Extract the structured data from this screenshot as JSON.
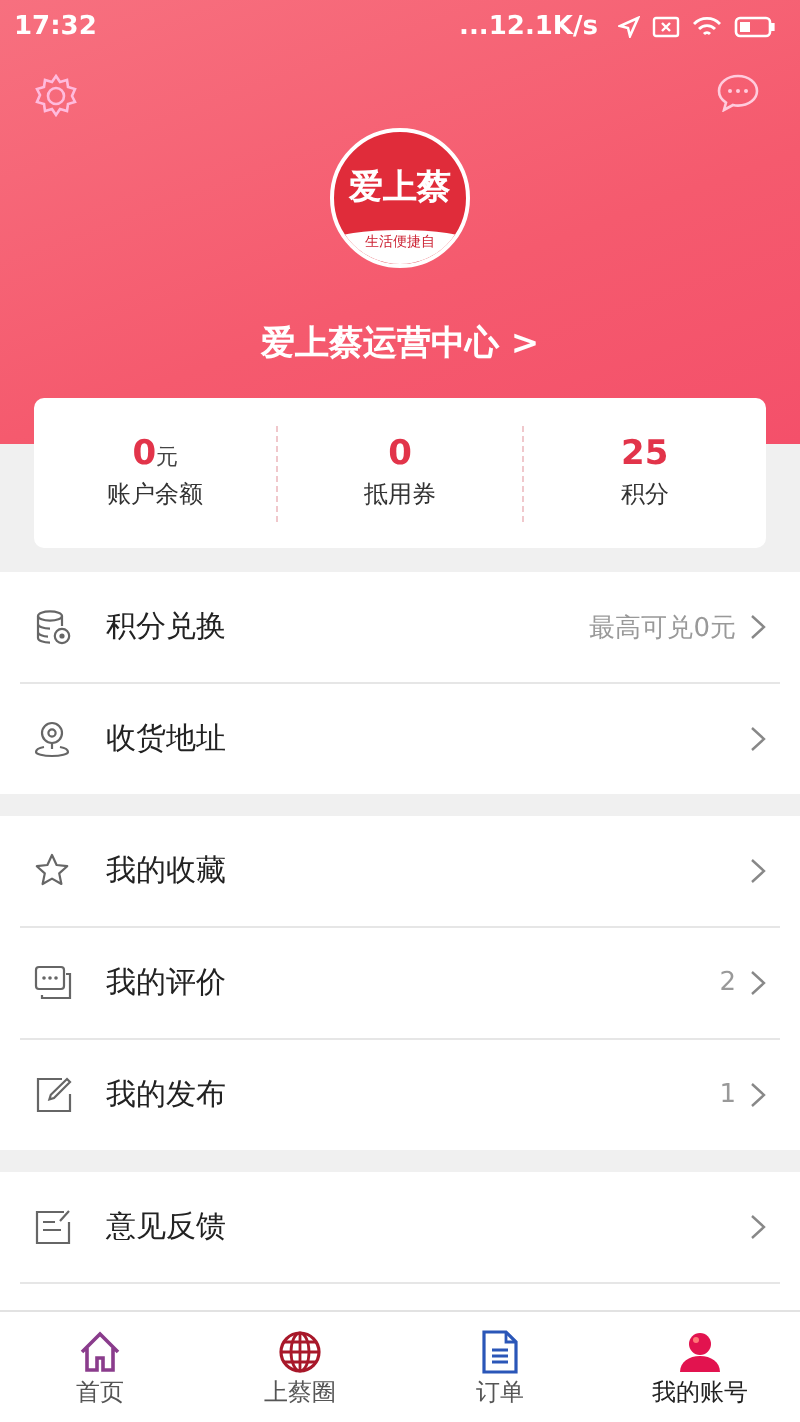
{
  "status_bar": {
    "time": "17:32",
    "network_speed": "...12.1K/s"
  },
  "header": {
    "logo": {
      "title": "爱上蔡",
      "subtitle": "生活便捷自"
    },
    "title": "爱上蔡运营中心 >"
  },
  "stats": [
    {
      "value": "0",
      "unit": "元",
      "label": "账户余额"
    },
    {
      "value": "0",
      "label": "抵用券"
    },
    {
      "value": "25",
      "label": "积分"
    }
  ],
  "menu_groups": [
    [
      {
        "label": "积分兑换",
        "detail": "最高可兑0元"
      },
      {
        "label": "收货地址"
      }
    ],
    [
      {
        "label": "我的收藏"
      },
      {
        "label": "我的评价",
        "detail": "2"
      },
      {
        "label": "我的发布",
        "detail": "1"
      }
    ],
    [
      {
        "label": "意见反馈"
      }
    ]
  ],
  "tab_bar": [
    {
      "label": "首页",
      "selected": false
    },
    {
      "label": "上蔡圈",
      "selected": false
    },
    {
      "label": "订单",
      "selected": false
    },
    {
      "label": "我的账号",
      "selected": true
    }
  ]
}
